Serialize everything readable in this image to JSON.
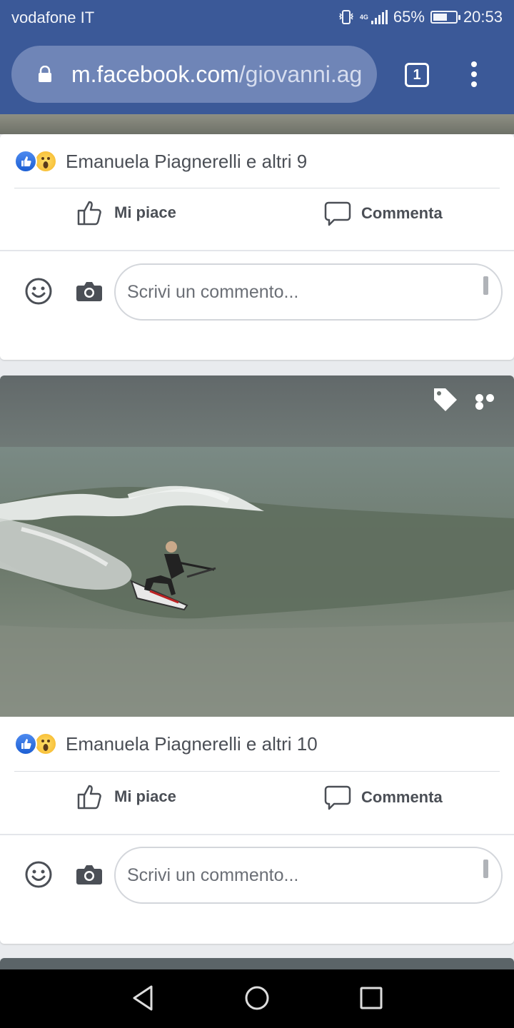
{
  "status": {
    "carrier": "vodafone IT",
    "network": "4G",
    "battery_percent": "65%",
    "battery_level": 0.65,
    "time": "20:53"
  },
  "browser": {
    "url_domain": "m.facebook.com",
    "url_path": "/giovanni.ag",
    "tab_count": "1"
  },
  "posts": [
    {
      "reactions_text": "Emanuela Piagnerelli e altri 9",
      "like_label": "Mi piace",
      "comment_label": "Commenta",
      "comment_placeholder": "Scrivi un commento..."
    },
    {
      "reactions_text": "Emanuela Piagnerelli e altri 10",
      "like_label": "Mi piace",
      "comment_label": "Commenta",
      "comment_placeholder": "Scrivi un commento..."
    }
  ],
  "colors": {
    "brand": "#3b5998",
    "like_blue": "#1c5fd4",
    "text_gray": "#4b4f56"
  }
}
